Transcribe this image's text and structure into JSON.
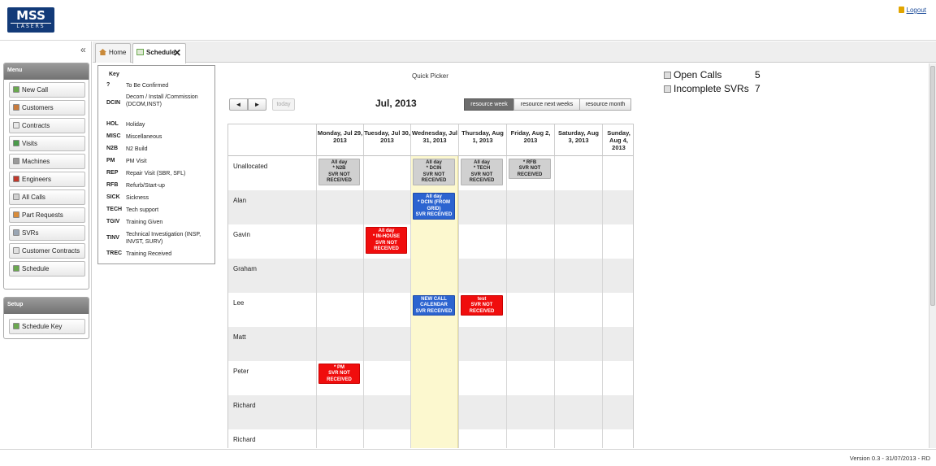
{
  "header": {
    "logo_line1": "MSS",
    "logo_line2": "LASERS",
    "logout": "Logout"
  },
  "sidebar": {
    "menu_title": "Menu",
    "menu_items": [
      {
        "label": "New Call",
        "icon": "new-call-icon",
        "color": "#6aa84f"
      },
      {
        "label": "Customers",
        "icon": "customers-icon",
        "color": "#c97b3c"
      },
      {
        "label": "Contracts",
        "icon": "contracts-icon",
        "color": "#e8e8e8"
      },
      {
        "label": "Visits",
        "icon": "visits-icon",
        "color": "#4a9b4a"
      },
      {
        "label": "Machines",
        "icon": "machines-icon",
        "color": "#9a9a9a"
      },
      {
        "label": "Engineers",
        "icon": "engineers-icon",
        "color": "#c0392b"
      },
      {
        "label": "All Calls",
        "icon": "all-calls-icon",
        "color": "#d0d0d0"
      },
      {
        "label": "Part Requests",
        "icon": "part-requests-icon",
        "color": "#d98c3a"
      },
      {
        "label": "SVRs",
        "icon": "svrs-icon",
        "color": "#9aa6b4"
      },
      {
        "label": "Customer Contracts",
        "icon": "customer-contracts-icon",
        "color": "#e0e0e0"
      },
      {
        "label": "Schedule",
        "icon": "schedule-icon",
        "color": "#6aa84f"
      }
    ],
    "setup_title": "Setup",
    "setup_items": [
      {
        "label": "Schedule Key",
        "icon": "schedule-key-icon",
        "color": "#6aa84f"
      }
    ]
  },
  "tabs": [
    {
      "label": "Home"
    },
    {
      "label": "Schedule"
    }
  ],
  "key": {
    "title": "Key",
    "items": [
      {
        "code": "?",
        "desc": "To Be Confirmed"
      },
      {
        "code": "DCIN",
        "desc": "Decom / Install /Commission (DCOM,INST)"
      },
      {
        "code": "HOL",
        "desc": "Holiday"
      },
      {
        "code": "MISC",
        "desc": "Miscellaneous"
      },
      {
        "code": "N2B",
        "desc": "N2 Build"
      },
      {
        "code": "PM",
        "desc": "PM Visit"
      },
      {
        "code": "REP",
        "desc": "Repair Visit (SBR, SFL)"
      },
      {
        "code": "RFB",
        "desc": "Refurb/Start-up"
      },
      {
        "code": "SICK",
        "desc": "Sickness"
      },
      {
        "code": "TECH",
        "desc": "Tech support"
      },
      {
        "code": "TGIV",
        "desc": "Training Given"
      },
      {
        "code": "TINV",
        "desc": "Technical Investigation (INSP, INVST, SURV)"
      },
      {
        "code": "TREC",
        "desc": "Training Received"
      }
    ]
  },
  "calendar": {
    "quick_picker": "Quick Picker",
    "prev": "◄",
    "next": "►",
    "today": "today",
    "title": "Jul, 2013",
    "views": [
      "resource week",
      "resource next weeks",
      "resource month"
    ],
    "active_view": "resource week",
    "days": [
      "Monday, Jul 29, 2013",
      "Tuesday, Jul 30, 2013",
      "Wednesday, Jul 31, 2013",
      "Thursday, Aug 1, 2013",
      "Friday, Aug 2, 2013",
      "Saturday, Aug 3, 2013",
      "Sunday, Aug 4, 2013"
    ],
    "today_day_index": 2,
    "resources": [
      "Unallocated",
      "Alan",
      "Gavin",
      "Graham",
      "Lee",
      "Matt",
      "Peter",
      "Richard",
      "Richard"
    ],
    "events": [
      {
        "resource": 0,
        "day": 0,
        "style": "grey",
        "lines": [
          "All day",
          "* N2B",
          "SVR NOT",
          "RECEIVED"
        ]
      },
      {
        "resource": 0,
        "day": 2,
        "style": "grey",
        "lines": [
          "All day",
          "* DCIN",
          "SVR NOT",
          "RECEIVED"
        ]
      },
      {
        "resource": 0,
        "day": 3,
        "style": "grey",
        "lines": [
          "All day",
          "* TECH",
          "SVR NOT",
          "RECEIVED"
        ]
      },
      {
        "resource": 0,
        "day": 4,
        "style": "grey",
        "lines": [
          "* RFB",
          "SVR NOT",
          "RECEIVED"
        ]
      },
      {
        "resource": 1,
        "day": 2,
        "style": "blue",
        "lines": [
          "All day",
          "* DCIN (FROM",
          "GRID)",
          "SVR RECEIVED"
        ]
      },
      {
        "resource": 2,
        "day": 1,
        "style": "red",
        "lines": [
          "All day",
          "* IN-HOUSE",
          "SVR NOT",
          "RECEIVED"
        ]
      },
      {
        "resource": 4,
        "day": 2,
        "style": "blue",
        "lines": [
          "NEW CALL",
          "CALENDAR",
          "SVR RECEIVED"
        ]
      },
      {
        "resource": 4,
        "day": 3,
        "style": "red",
        "lines": [
          "test",
          "SVR NOT",
          "RECEIVED"
        ]
      },
      {
        "resource": 6,
        "day": 0,
        "style": "red",
        "lines": [
          "* PM",
          "SVR NOT",
          "RECEIVED"
        ]
      }
    ]
  },
  "stats": [
    {
      "label": "Open Calls",
      "value": "5"
    },
    {
      "label": "Incomplete SVRs",
      "value": "7"
    }
  ],
  "footer": {
    "version": "Version 0.3 - 31/07/2013 - RD"
  }
}
